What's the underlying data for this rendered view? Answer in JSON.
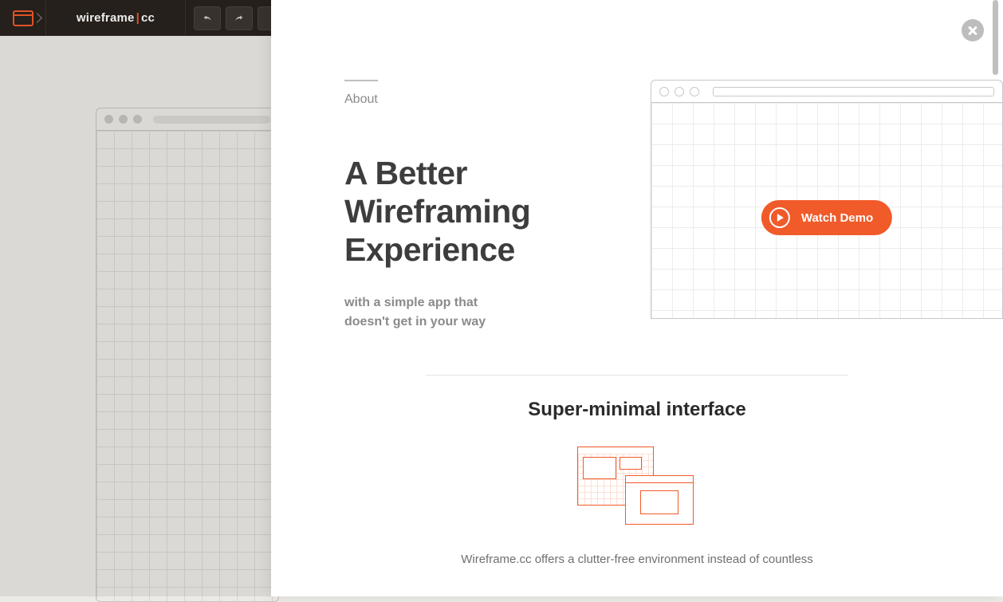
{
  "colors": {
    "accent": "#f15a29",
    "toolbar_bg": "#28231f",
    "body_bg": "#eceae7",
    "muted": "#8a8a8a"
  },
  "brand": {
    "name": "wireframe",
    "separator": "|",
    "suffix": "cc"
  },
  "toolbar": {
    "undo": "undo",
    "redo": "redo"
  },
  "panel": {
    "tab_label": "About",
    "headline_1": "A Better",
    "headline_2": "Wireframing",
    "headline_3": "Experience",
    "tagline_1": "with a simple app that",
    "tagline_2": "doesn't get in your way",
    "watch_demo_label": "Watch Demo",
    "subheading": "Super-minimal interface",
    "body_copy": "Wireframe.cc offers a clutter-free environment instead of countless"
  }
}
